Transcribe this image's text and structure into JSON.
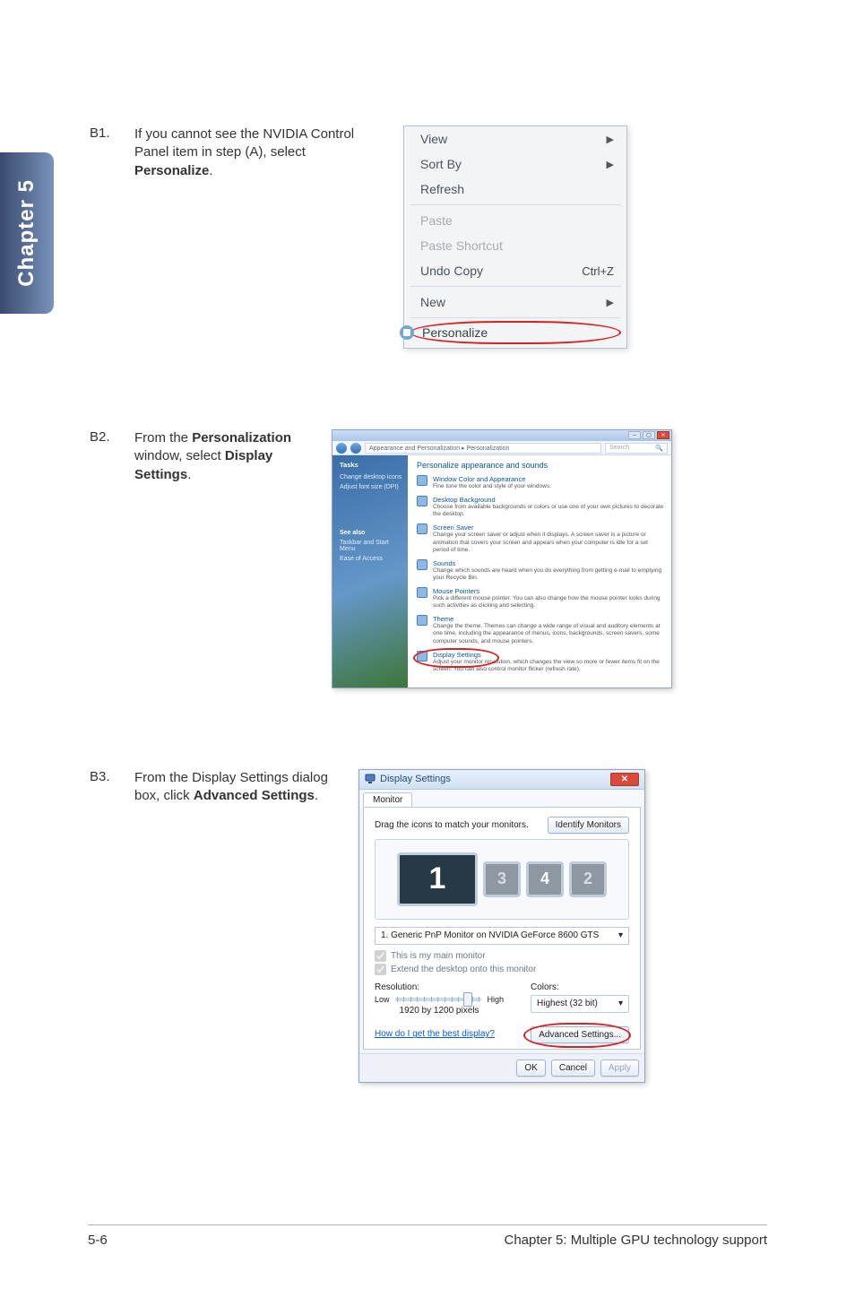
{
  "sidebar_tab": "Chapter 5",
  "steps": {
    "b1": {
      "num": "B1.",
      "text_prefix": "If you cannot see the NVIDIA Control Panel item in step (A), select ",
      "bold": "Personalize",
      "text_suffix": "."
    },
    "b2": {
      "num": "B2.",
      "text_prefix": "From the ",
      "bold1": "Personalization",
      "text_mid": " window, select ",
      "bold2": "Display Settings",
      "text_suffix": "."
    },
    "b3": {
      "num": "B3.",
      "text_prefix": "From the Display Settings dialog box, click ",
      "bold": "Advanced Settings",
      "text_suffix": "."
    }
  },
  "context_menu": {
    "view": "View",
    "sort_by": "Sort By",
    "refresh": "Refresh",
    "paste": "Paste",
    "paste_shortcut": "Paste Shortcut",
    "undo_copy": "Undo Copy",
    "undo_copy_short": "Ctrl+Z",
    "new": "New",
    "personalize": "Personalize"
  },
  "pers": {
    "breadcrumb": "Appearance and Personalization  ▸  Personalization",
    "search_placeholder": "Search",
    "side": {
      "tasks": "Tasks",
      "change_icons": "Change desktop icons",
      "adjust_font": "Adjust font size (DPI)",
      "see_also": "See also",
      "taskbar": "Taskbar and Start Menu",
      "ease": "Ease of Access"
    },
    "main_title": "Personalize appearance and sounds",
    "items": [
      {
        "title": "Window Color and Appearance",
        "desc": "Fine tune the color and style of your windows."
      },
      {
        "title": "Desktop Background",
        "desc": "Choose from available backgrounds or colors or use one of your own pictures to decorate the desktop."
      },
      {
        "title": "Screen Saver",
        "desc": "Change your screen saver or adjust when it displays. A screen saver is a picture or animation that covers your screen and appears when your computer is idle for a set period of time."
      },
      {
        "title": "Sounds",
        "desc": "Change which sounds are heard when you do everything from getting e-mail to emptying your Recycle Bin."
      },
      {
        "title": "Mouse Pointers",
        "desc": "Pick a different mouse pointer. You can also change how the mouse pointer looks during such activities as clicking and selecting."
      },
      {
        "title": "Theme",
        "desc": "Change the theme. Themes can change a wide range of visual and auditory elements at one time, including the appearance of menus, icons, backgrounds, screen savers, some computer sounds, and mouse pointers."
      },
      {
        "title": "Display Settings",
        "desc": "Adjust your monitor resolution, which changes the view so more or fewer items fit on the screen. You can also control monitor flicker (refresh rate)."
      }
    ]
  },
  "ds": {
    "title": "Display Settings",
    "tab": "Monitor",
    "drag_text": "Drag the icons to match your monitors.",
    "identify": "Identify Monitors",
    "monitors": {
      "m1": "1",
      "m3": "3",
      "m4": "4",
      "m2": "2"
    },
    "select": "1. Generic PnP Monitor on NVIDIA GeForce 8600 GTS",
    "check_main": "This is my main monitor",
    "check_extend": "Extend the desktop onto this monitor",
    "res_label": "Resolution:",
    "low": "Low",
    "high": "High",
    "res_value": "1920 by 1200 pixels",
    "colors_label": "Colors:",
    "colors_value": "Highest (32 bit)",
    "help_link": "How do I get the best display?",
    "adv_btn": "Advanced Settings...",
    "ok": "OK",
    "cancel": "Cancel",
    "apply": "Apply"
  },
  "footer": {
    "left": "5-6",
    "right": "Chapter 5: Multiple GPU technology support"
  }
}
